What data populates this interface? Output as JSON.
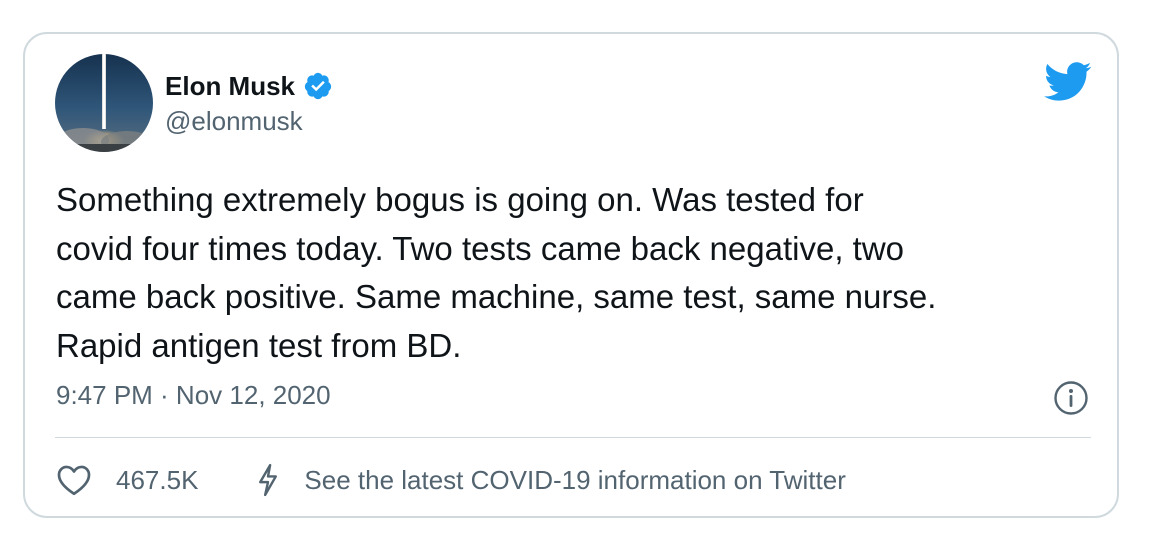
{
  "author": {
    "name": "Elon Musk",
    "handle": "@elonmusk",
    "verified": true
  },
  "tweet": {
    "text": "Something extremely bogus is going on. Was tested for\ncovid four times today. Two tests came back negative, two\ncame back positive. Same machine, same test, same nurse.\nRapid antigen test from BD.",
    "timestamp": "9:47 PM · Nov 12, 2020"
  },
  "actions": {
    "like_count": "467.5K",
    "covid_info_label": "See the latest COVID-19 information on Twitter"
  },
  "icons": {
    "brand": "twitter-bird-icon",
    "verified": "verified-badge-icon",
    "info": "info-icon",
    "like": "heart-icon",
    "covid": "lightning-bolt-icon"
  },
  "colors": {
    "brand_blue": "#1d9bf0",
    "text_primary": "#0f1419",
    "text_secondary": "#536471",
    "border": "#cfd9de"
  }
}
